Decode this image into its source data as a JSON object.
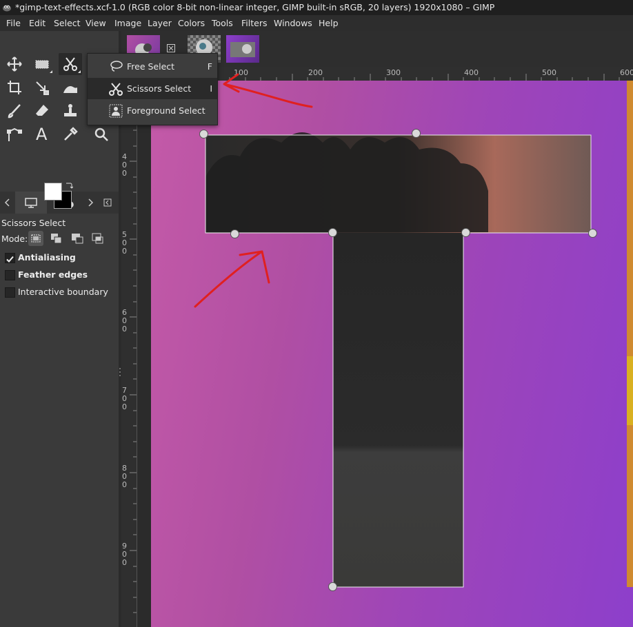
{
  "window": {
    "title": "*gimp-text-effects.xcf-1.0 (RGB color 8-bit non-linear integer, GIMP built-in sRGB, 20 layers) 1920x1080 – GIMP"
  },
  "menubar": {
    "items": [
      "File",
      "Edit",
      "Select",
      "View",
      "Image",
      "Layer",
      "Colors",
      "Tools",
      "Filters",
      "Windows",
      "Help"
    ]
  },
  "toolbox": {
    "tools": [
      {
        "name": "move-icon"
      },
      {
        "name": "rect-select-icon"
      },
      {
        "name": "scissors-icon",
        "active": true
      },
      {
        "name": "crop-icon"
      },
      {
        "name": "unified-transform-icon"
      },
      {
        "name": "warp-icon"
      },
      {
        "name": "paintbrush-icon"
      },
      {
        "name": "eraser-icon"
      },
      {
        "name": "clone-icon"
      },
      {
        "name": "paths-icon"
      },
      {
        "name": "text-icon",
        "glyph": "A"
      },
      {
        "name": "color-picker-icon"
      },
      {
        "name": "zoom-icon"
      }
    ],
    "colors": {
      "foreground": "#ffffff",
      "background": "#000000"
    }
  },
  "popup": {
    "items": [
      {
        "label": "Free Select",
        "shortcut": "F",
        "icon": "lasso-icon"
      },
      {
        "label": "Scissors Select",
        "shortcut": "I",
        "icon": "scissors-icon",
        "selected": true
      },
      {
        "label": "Foreground Select",
        "shortcut": "",
        "icon": "foreground-select-icon"
      }
    ]
  },
  "tool_options": {
    "title": "Scissors Select",
    "mode_label": "Mode:",
    "options": [
      {
        "label": "Antialiasing",
        "checked": true
      },
      {
        "label": "Feather edges",
        "checked": false
      },
      {
        "label": "Interactive boundary",
        "checked": false
      }
    ]
  },
  "ruler": {
    "top_labels": [
      "100",
      "200",
      "300",
      "400",
      "500",
      "600"
    ],
    "left_labels": [
      "400",
      "500",
      "600",
      "700",
      "800",
      "900"
    ]
  },
  "colors": {
    "canvas_start": "#c45aa8",
    "canvas_end": "#8d3fcb",
    "annotation": "#e02020"
  }
}
